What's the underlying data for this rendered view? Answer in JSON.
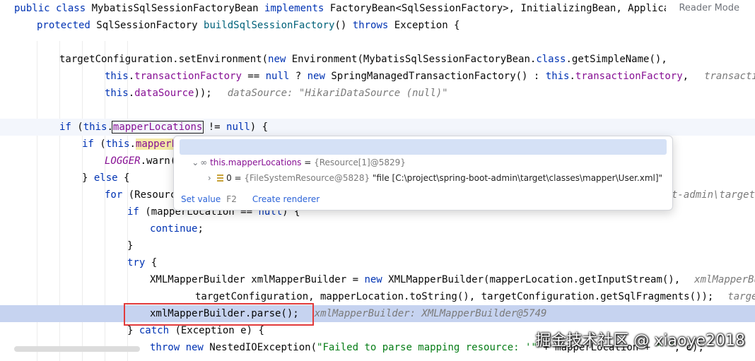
{
  "editor": {
    "reader_mode_label": "Reader Mode",
    "lines": {
      "l1": {
        "kw1": "public class ",
        "t1": "MybatisSqlSessionFactoryBean ",
        "kw2": "implements ",
        "t2": "FactoryBean<SqlSessionFactory>, InitializingBean, ApplicationLi"
      },
      "l2": {
        "kw1": "protected ",
        "t1": "SqlSessionFactory ",
        "m": "buildSqlSessionFactory",
        "t2": "() ",
        "kw2": "throws ",
        "t3": "Exception {"
      },
      "l3": {
        "t1": "targetConfiguration.setEnvironment(",
        "kw1": "new ",
        "t2": "Environment(MybatisSqlSessionFactoryBean.",
        "kw2": "class",
        "t3": ".getSimpleName(),"
      },
      "l4": {
        "kw1": "this",
        "t1": ".",
        "f1": "transactionFactory",
        "t2": " == ",
        "kw2": "null",
        "t3": " ? ",
        "kw3": "new ",
        "t4": "SpringManagedTransactionFactory() : ",
        "kw4": "this",
        "t5": ".",
        "f2": "transactionFactory",
        "t6": ",",
        "hint": "transactionFact"
      },
      "l5": {
        "kw1": "this",
        "t1": ".",
        "f1": "dataSource",
        "t2": "));",
        "hint": "dataSource: \"HikariDataSource (null)\""
      },
      "l6": {
        "kw1": "if ",
        "t1": "(",
        "kw2": "this",
        "t2": ".",
        "f1": "mapperLocations",
        "t3": " != ",
        "kw3": "null",
        "t4": ") {"
      },
      "l7": {
        "kw1": "if ",
        "t1": "(",
        "kw2": "this",
        "t2": ".",
        "f1": "mapperL"
      },
      "l8": {
        "s1": "LOGGER",
        "t1": ".warn("
      },
      "l9": {
        "t1": "} ",
        "kw1": "else",
        "t2": " {"
      },
      "l10": {
        "kw1": "for ",
        "t1": "(Resourc",
        "tail": "t-admin\\target\\"
      },
      "l11": {
        "kw1": "if ",
        "t1": "(mapperLocation == ",
        "kw2": "null",
        "t2": ") {"
      },
      "l12": {
        "kw1": "continue",
        "t1": ";"
      },
      "l13": {
        "t1": "}"
      },
      "l14": {
        "kw1": "try",
        "t1": " {"
      },
      "l15": {
        "t1": "XMLMapperBuilder xmlMapperBuilder = ",
        "kw1": "new ",
        "t2": "XMLMapperBuilder(mapperLocation.getInputStream(),",
        "hint": "xmlMapperBuilder"
      },
      "l16": {
        "t1": "targetConfiguration, mapperLocation.toString(), targetConfiguration.getSqlFragments());",
        "hint": "targetConf"
      },
      "l17": {
        "t1": "xmlMapperBuilder.parse();",
        "hint": "xmlMapperBuilder: XMLMapperBuilder@5749"
      },
      "l18": {
        "t1": "} ",
        "kw1": "catch",
        "t2": " (Exception e) {"
      },
      "l19": {
        "kw1": "throw new ",
        "t1": "NestedIOException(",
        "s1": "\"Failed to parse mapping resource: '\"",
        "t2": " + mapperLocation + ",
        "s2": "\"'\"",
        "t3": ", e);"
      }
    }
  },
  "popup": {
    "row1": {
      "icon": "infinity-icon",
      "name": "this.mapperLocations",
      "eq": " = ",
      "value": "{Resource[1]@5829}"
    },
    "row2": {
      "icon": "list-icon",
      "index": "0",
      "eq": " = ",
      "type": "{FileSystemResource@5828} ",
      "value": "\"file [C:\\project\\spring-boot-admin\\target\\classes\\mapper\\User.xml]\""
    },
    "set_value_label": "Set value",
    "set_value_key": "F2",
    "create_renderer_label": "Create renderer"
  },
  "watermark": "掘金技术社区 @ xiaoye2018"
}
